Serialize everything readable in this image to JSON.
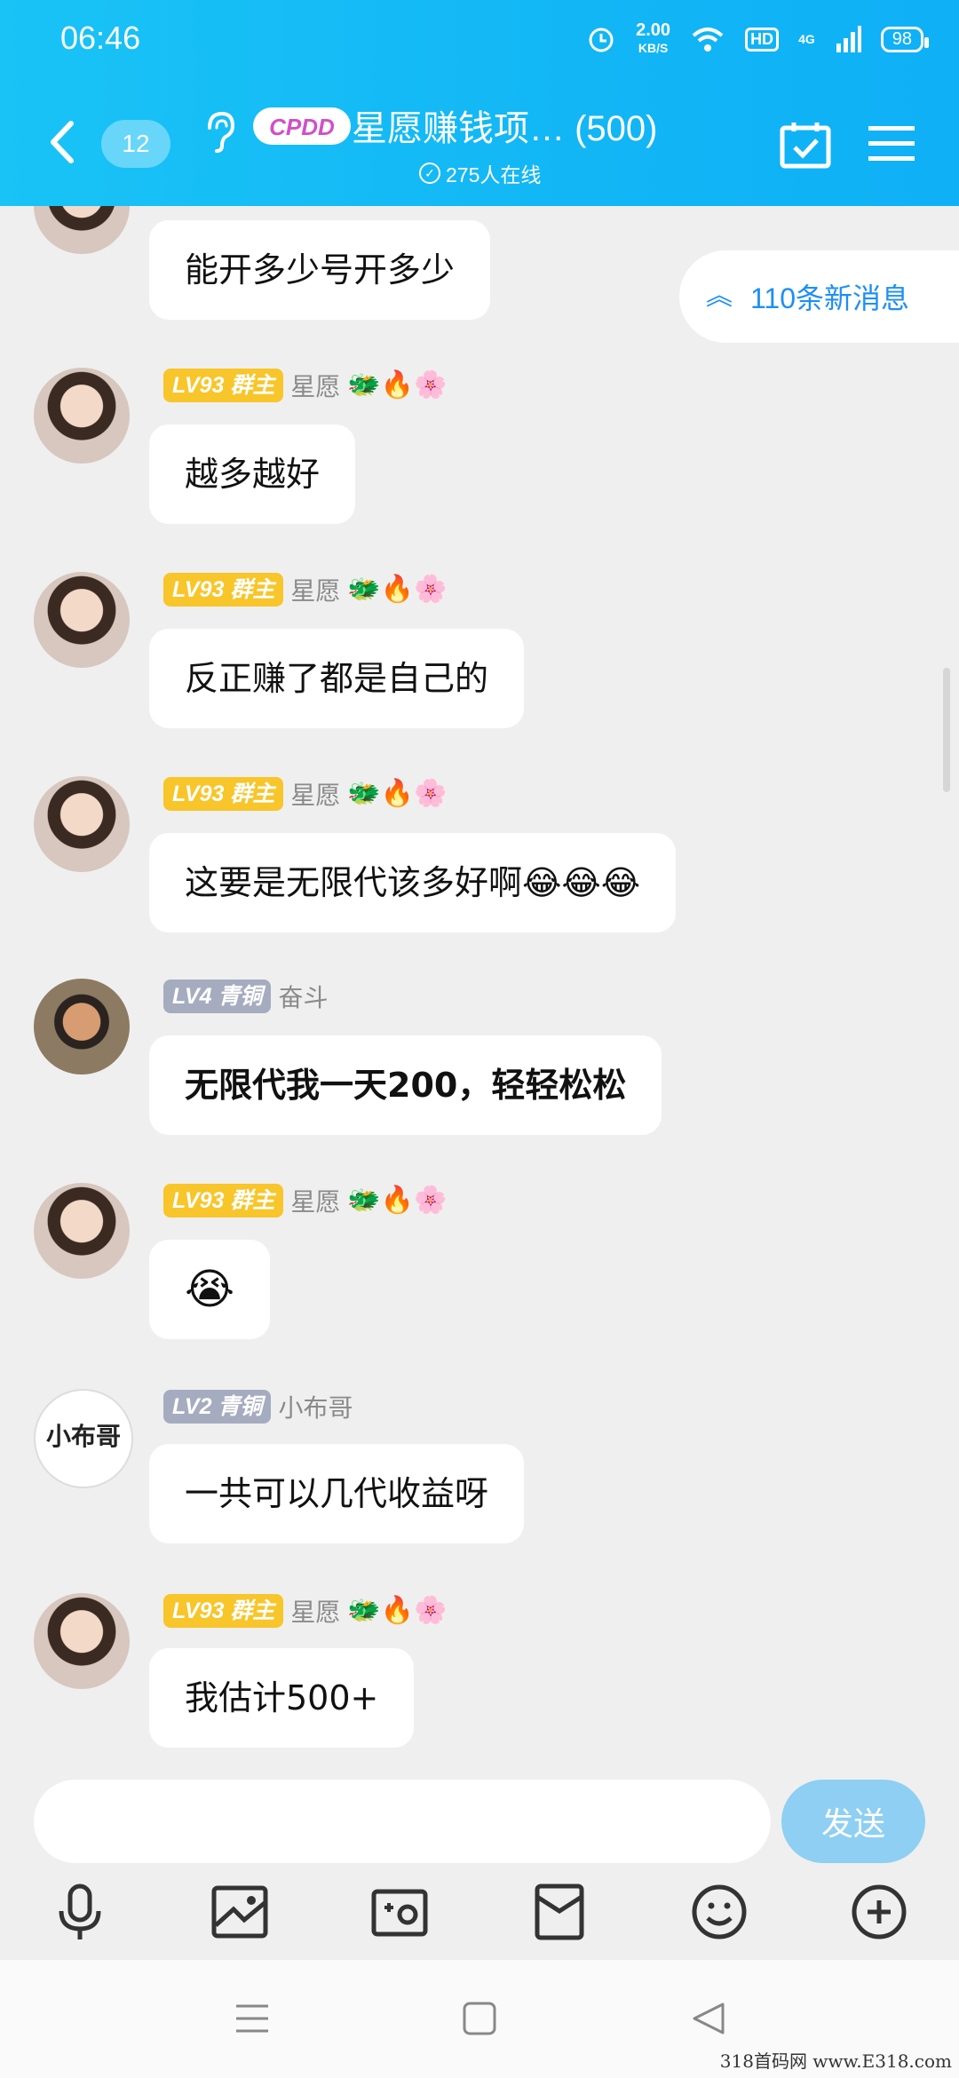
{
  "status_bar": {
    "time": "06:46",
    "speed": "2.00",
    "speed_unit": "KB/S",
    "hd": "HD",
    "network": "4G",
    "battery": "98"
  },
  "header": {
    "unread_count": "12",
    "group_logo_text": "CPDD",
    "group_title": "星愿赚钱项… (500)",
    "online_text": "275人在线"
  },
  "new_messages_label": "110条新消息",
  "messages": [
    {
      "avatar": "woman",
      "level": "",
      "role": "",
      "name": "",
      "text": "能开多少号开多少"
    },
    {
      "avatar": "woman",
      "level": "LV93",
      "role": "群主",
      "name": "星愿",
      "text": "越多越好"
    },
    {
      "avatar": "woman",
      "level": "LV93",
      "role": "群主",
      "name": "星愿",
      "text": "反正赚了都是自己的"
    },
    {
      "avatar": "woman",
      "level": "LV93",
      "role": "群主",
      "name": "星愿",
      "text": "这要是无限代该多好啊😂😂😂"
    },
    {
      "avatar": "man",
      "level": "LV4",
      "role": "青铜",
      "name": "奋斗",
      "text": "无限代我一天200，轻轻松松"
    },
    {
      "avatar": "woman",
      "level": "LV93",
      "role": "群主",
      "name": "星愿",
      "text": "😭"
    },
    {
      "avatar": "xbg",
      "avatar_text": "小布哥",
      "level": "LV2",
      "role": "青铜",
      "name": "小布哥",
      "text": "一共可以几代收益呀"
    },
    {
      "avatar": "woman",
      "level": "LV93",
      "role": "群主",
      "name": "星愿",
      "text": "我估计500+"
    }
  ],
  "badges_deco": "🐲🔥🌸",
  "input": {
    "placeholder": "",
    "send_label": "发送"
  },
  "toolbar_icons": [
    "microphone-icon",
    "picture-icon",
    "camera-icon",
    "red-packet-icon",
    "emoji-icon",
    "plus-icon"
  ],
  "watermark": "318首码网 www.E318.com",
  "colors": {
    "header": "#12b6f5",
    "gold_badge": "#f8c52a",
    "bronze_badge": "#a6acbf",
    "send_button": "#8ecff3",
    "link_blue": "#1e8ff5"
  }
}
